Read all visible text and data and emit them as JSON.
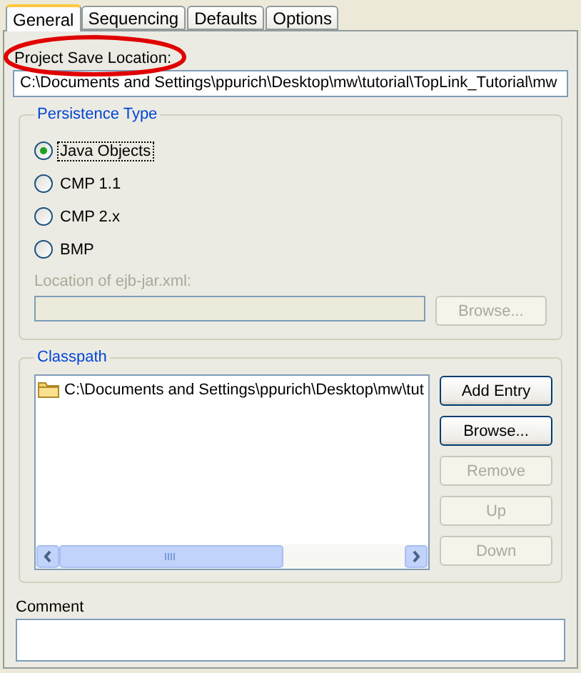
{
  "tabs": [
    {
      "label": "General",
      "selected": true
    },
    {
      "label": "Sequencing",
      "selected": false
    },
    {
      "label": "Defaults",
      "selected": false
    },
    {
      "label": "Options",
      "selected": false
    }
  ],
  "project_save_location": {
    "label": "Project Save Location:",
    "value": "C:\\Documents and Settings\\ppurich\\Desktop\\mw\\tutorial\\TopLink_Tutorial\\mw",
    "annotated": true
  },
  "persistence_type": {
    "title": "Persistence Type",
    "options": [
      {
        "label": "Java Objects",
        "selected": true
      },
      {
        "label": "CMP 1.1",
        "selected": false
      },
      {
        "label": "CMP 2.x",
        "selected": false
      },
      {
        "label": "BMP",
        "selected": false
      }
    ],
    "ejb_jar": {
      "label": "Location of ejb-jar.xml:",
      "disabled": true,
      "button": {
        "label": "Browse...",
        "disabled": true
      }
    }
  },
  "classpath": {
    "title": "Classpath",
    "entries": [
      "C:\\Documents and Settings\\ppurich\\Desktop\\mw\\tut"
    ],
    "buttons": [
      {
        "label": "Add Entry",
        "disabled": false
      },
      {
        "label": "Browse...",
        "disabled": false
      },
      {
        "label": "Remove",
        "disabled": true
      },
      {
        "label": "Up",
        "disabled": true
      },
      {
        "label": "Down",
        "disabled": true
      }
    ]
  },
  "comment": {
    "label": "Comment"
  }
}
